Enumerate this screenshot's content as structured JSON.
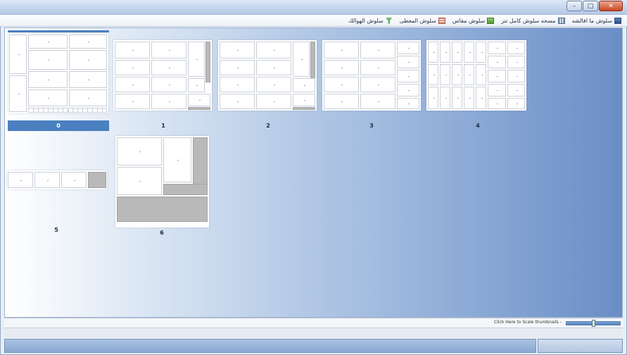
{
  "window": {
    "title": "",
    "buttons": {
      "minimize": "–",
      "maximize": "□",
      "close": "✕"
    }
  },
  "toolbar": {
    "items": [
      {
        "label": "سلوش ما افالشه",
        "icon": "chart-icon"
      },
      {
        "label": "مسحه سلوش كامل تنز",
        "icon": "grid-icon"
      },
      {
        "label": "سلوش مقاس",
        "icon": "green-box-icon"
      },
      {
        "label": "سلوش المعطى",
        "icon": "table-icon"
      },
      {
        "label": "سلوش الهوالك",
        "icon": "filter-icon"
      }
    ]
  },
  "pages": [
    {
      "number": "0",
      "selected": true
    },
    {
      "number": "1",
      "selected": false
    },
    {
      "number": "2",
      "selected": false
    },
    {
      "number": "3",
      "selected": false
    },
    {
      "number": "4",
      "selected": false
    },
    {
      "number": "5",
      "selected": false
    },
    {
      "number": "6",
      "selected": false
    }
  ],
  "zoom": {
    "label": "Click Here to Scale thumbnails -",
    "level": 0.5
  },
  "colors": {
    "accent": "#4a7fc0",
    "canvas_start": "#ffffff",
    "canvas_end": "#6a8dc6"
  }
}
